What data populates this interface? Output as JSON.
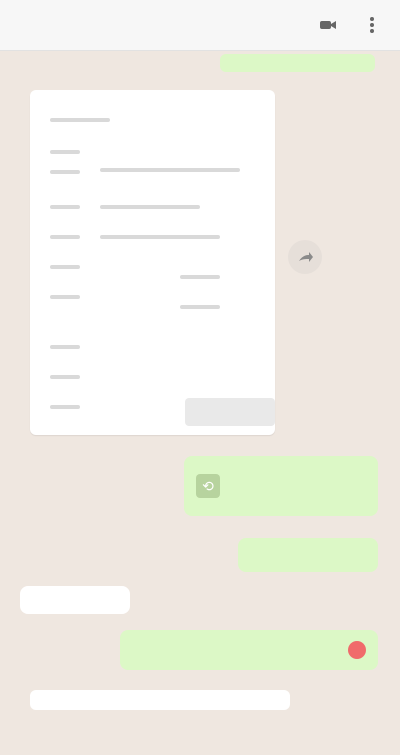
{
  "header": {
    "title": "",
    "subtitle": "",
    "icons": [
      "video-call-icon",
      "more-options-icon"
    ]
  },
  "messages": {
    "top_sent": "",
    "document_caption": "",
    "link_message": "",
    "short_message": "",
    "incoming_short": "",
    "long_message": "",
    "bottom_preview": ""
  }
}
